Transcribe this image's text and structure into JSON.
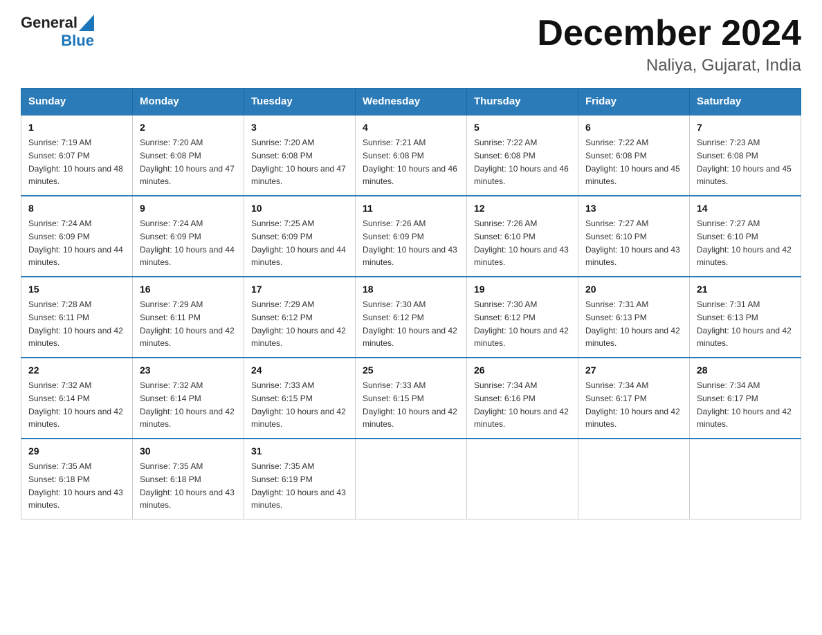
{
  "logo": {
    "word1": "General",
    "word2": "Blue"
  },
  "title": "December 2024",
  "subtitle": "Naliya, Gujarat, India",
  "days_of_week": [
    "Sunday",
    "Monday",
    "Tuesday",
    "Wednesday",
    "Thursday",
    "Friday",
    "Saturday"
  ],
  "weeks": [
    [
      {
        "day": "1",
        "sunrise": "7:19 AM",
        "sunset": "6:07 PM",
        "daylight": "10 hours and 48 minutes."
      },
      {
        "day": "2",
        "sunrise": "7:20 AM",
        "sunset": "6:08 PM",
        "daylight": "10 hours and 47 minutes."
      },
      {
        "day": "3",
        "sunrise": "7:20 AM",
        "sunset": "6:08 PM",
        "daylight": "10 hours and 47 minutes."
      },
      {
        "day": "4",
        "sunrise": "7:21 AM",
        "sunset": "6:08 PM",
        "daylight": "10 hours and 46 minutes."
      },
      {
        "day": "5",
        "sunrise": "7:22 AM",
        "sunset": "6:08 PM",
        "daylight": "10 hours and 46 minutes."
      },
      {
        "day": "6",
        "sunrise": "7:22 AM",
        "sunset": "6:08 PM",
        "daylight": "10 hours and 45 minutes."
      },
      {
        "day": "7",
        "sunrise": "7:23 AM",
        "sunset": "6:08 PM",
        "daylight": "10 hours and 45 minutes."
      }
    ],
    [
      {
        "day": "8",
        "sunrise": "7:24 AM",
        "sunset": "6:09 PM",
        "daylight": "10 hours and 44 minutes."
      },
      {
        "day": "9",
        "sunrise": "7:24 AM",
        "sunset": "6:09 PM",
        "daylight": "10 hours and 44 minutes."
      },
      {
        "day": "10",
        "sunrise": "7:25 AM",
        "sunset": "6:09 PM",
        "daylight": "10 hours and 44 minutes."
      },
      {
        "day": "11",
        "sunrise": "7:26 AM",
        "sunset": "6:09 PM",
        "daylight": "10 hours and 43 minutes."
      },
      {
        "day": "12",
        "sunrise": "7:26 AM",
        "sunset": "6:10 PM",
        "daylight": "10 hours and 43 minutes."
      },
      {
        "day": "13",
        "sunrise": "7:27 AM",
        "sunset": "6:10 PM",
        "daylight": "10 hours and 43 minutes."
      },
      {
        "day": "14",
        "sunrise": "7:27 AM",
        "sunset": "6:10 PM",
        "daylight": "10 hours and 42 minutes."
      }
    ],
    [
      {
        "day": "15",
        "sunrise": "7:28 AM",
        "sunset": "6:11 PM",
        "daylight": "10 hours and 42 minutes."
      },
      {
        "day": "16",
        "sunrise": "7:29 AM",
        "sunset": "6:11 PM",
        "daylight": "10 hours and 42 minutes."
      },
      {
        "day": "17",
        "sunrise": "7:29 AM",
        "sunset": "6:12 PM",
        "daylight": "10 hours and 42 minutes."
      },
      {
        "day": "18",
        "sunrise": "7:30 AM",
        "sunset": "6:12 PM",
        "daylight": "10 hours and 42 minutes."
      },
      {
        "day": "19",
        "sunrise": "7:30 AM",
        "sunset": "6:12 PM",
        "daylight": "10 hours and 42 minutes."
      },
      {
        "day": "20",
        "sunrise": "7:31 AM",
        "sunset": "6:13 PM",
        "daylight": "10 hours and 42 minutes."
      },
      {
        "day": "21",
        "sunrise": "7:31 AM",
        "sunset": "6:13 PM",
        "daylight": "10 hours and 42 minutes."
      }
    ],
    [
      {
        "day": "22",
        "sunrise": "7:32 AM",
        "sunset": "6:14 PM",
        "daylight": "10 hours and 42 minutes."
      },
      {
        "day": "23",
        "sunrise": "7:32 AM",
        "sunset": "6:14 PM",
        "daylight": "10 hours and 42 minutes."
      },
      {
        "day": "24",
        "sunrise": "7:33 AM",
        "sunset": "6:15 PM",
        "daylight": "10 hours and 42 minutes."
      },
      {
        "day": "25",
        "sunrise": "7:33 AM",
        "sunset": "6:15 PM",
        "daylight": "10 hours and 42 minutes."
      },
      {
        "day": "26",
        "sunrise": "7:34 AM",
        "sunset": "6:16 PM",
        "daylight": "10 hours and 42 minutes."
      },
      {
        "day": "27",
        "sunrise": "7:34 AM",
        "sunset": "6:17 PM",
        "daylight": "10 hours and 42 minutes."
      },
      {
        "day": "28",
        "sunrise": "7:34 AM",
        "sunset": "6:17 PM",
        "daylight": "10 hours and 42 minutes."
      }
    ],
    [
      {
        "day": "29",
        "sunrise": "7:35 AM",
        "sunset": "6:18 PM",
        "daylight": "10 hours and 43 minutes."
      },
      {
        "day": "30",
        "sunrise": "7:35 AM",
        "sunset": "6:18 PM",
        "daylight": "10 hours and 43 minutes."
      },
      {
        "day": "31",
        "sunrise": "7:35 AM",
        "sunset": "6:19 PM",
        "daylight": "10 hours and 43 minutes."
      },
      null,
      null,
      null,
      null
    ]
  ]
}
